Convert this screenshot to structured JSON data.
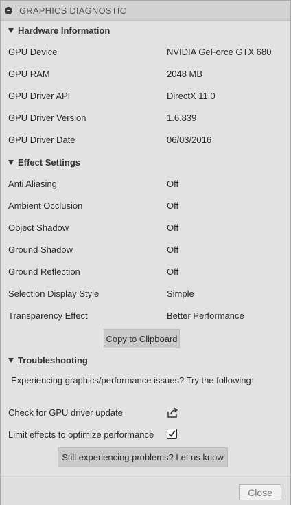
{
  "window": {
    "title": "GRAPHICS DIAGNOSTIC"
  },
  "hardware": {
    "heading": "Hardware Information",
    "rows": [
      {
        "label": "GPU Device",
        "value": "NVIDIA GeForce GTX 680"
      },
      {
        "label": "GPU RAM",
        "value": "2048 MB"
      },
      {
        "label": "GPU Driver API",
        "value": "DirectX 11.0"
      },
      {
        "label": "GPU Driver Version",
        "value": "1.6.839"
      },
      {
        "label": "GPU Driver Date",
        "value": "06/03/2016"
      }
    ]
  },
  "effects": {
    "heading": "Effect Settings",
    "rows": [
      {
        "label": "Anti Aliasing",
        "value": "Off"
      },
      {
        "label": "Ambient Occlusion",
        "value": "Off"
      },
      {
        "label": "Object Shadow",
        "value": "Off"
      },
      {
        "label": "Ground Shadow",
        "value": "Off"
      },
      {
        "label": "Ground Reflection",
        "value": "Off"
      },
      {
        "label": "Selection Display Style",
        "value": "Simple"
      },
      {
        "label": "Transparency Effect",
        "value": "Better Performance"
      }
    ],
    "copy_button": "Copy to Clipboard"
  },
  "troubleshooting": {
    "heading": "Troubleshooting",
    "note": "Experiencing graphics/performance issues? Try the following:",
    "driver_update_label": "Check for GPU driver update",
    "driver_update_icon": "external-link-icon",
    "limit_effects_label": "Limit effects to optimize performance",
    "limit_effects_checked": true,
    "help_button": "Still experiencing problems? Let us know"
  },
  "footer": {
    "close_button": "Close"
  }
}
